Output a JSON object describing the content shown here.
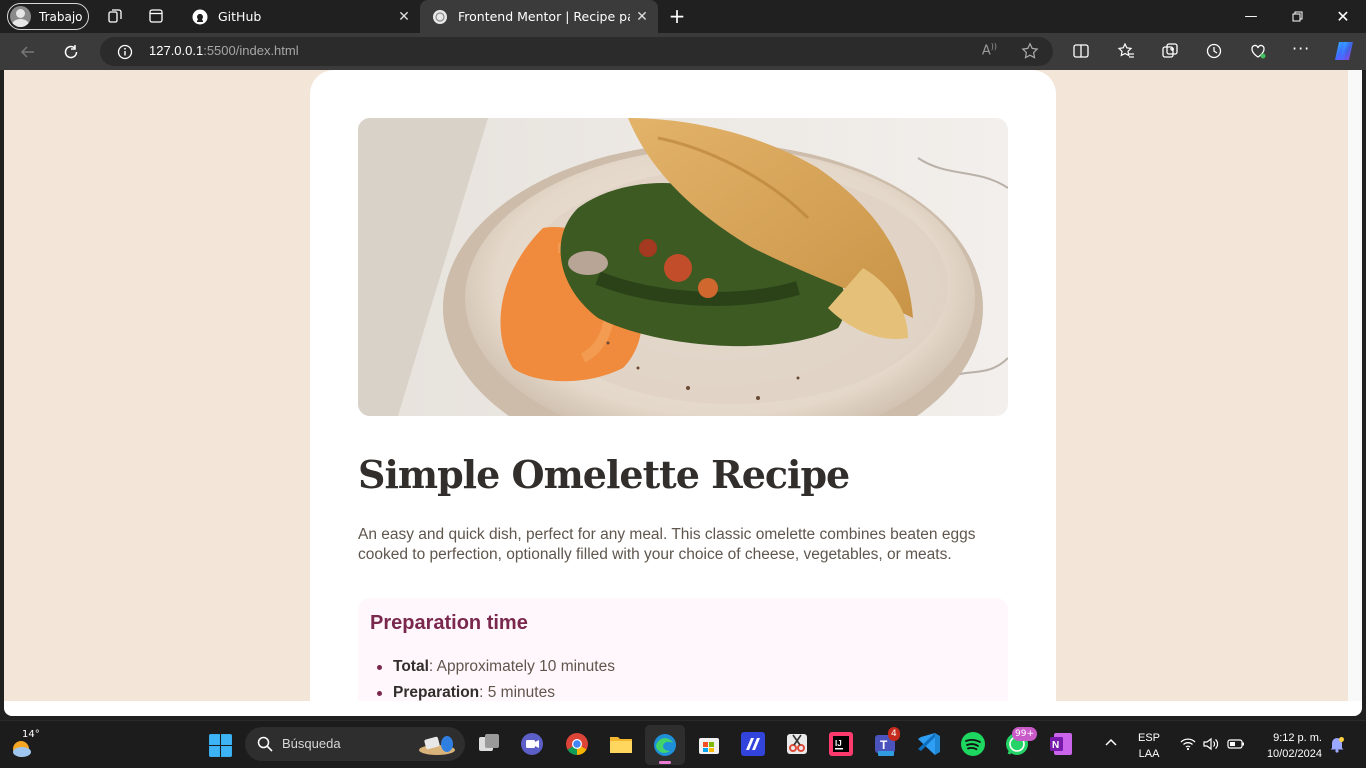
{
  "browser": {
    "profile_label": "Trabajo",
    "tabs": [
      {
        "label": "GitHub"
      },
      {
        "label": "Frontend Mentor | Recipe page"
      }
    ],
    "url_host": "127.0.0.1",
    "url_path": ":5500/index.html"
  },
  "page": {
    "title": "Simple Omelette Recipe",
    "description": "An easy and quick dish, perfect for any meal. This classic omelette combines beaten eggs cooked to perfection, optionally filled with your choice of cheese, vegetables, or meats.",
    "prep": {
      "heading": "Preparation time",
      "items": [
        {
          "term": "Total",
          "text": ": Approximately 10 minutes"
        },
        {
          "term": "Preparation",
          "text": ": 5 minutes"
        }
      ]
    },
    "colors": {
      "page_bg": "#f3e5d7",
      "title": "#312e2c",
      "accent": "#7a284e"
    }
  },
  "taskbar": {
    "weather_temp": "14°",
    "search_placeholder": "Búsqueda",
    "teams_badge": "4",
    "whatsapp_badge": "99+",
    "lang_line1": "ESP",
    "lang_line2": "LAA",
    "time": "9:12 p. m.",
    "date": "10/02/2024"
  }
}
